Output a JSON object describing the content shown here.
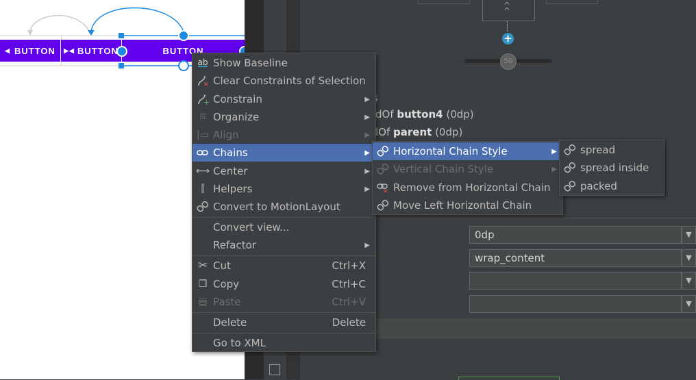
{
  "canvas": {
    "buttons": [
      "BUTTON",
      "BUTTON",
      "BUTTON"
    ]
  },
  "right_panel": {
    "slider_value": "50",
    "constraint_lines": [
      {
        "prefix": "dOf ",
        "target": "button4",
        "suffix": " (0dp)"
      },
      {
        "prefix": "lOf ",
        "target": "parent",
        "suffix": " (0dp)"
      }
    ],
    "fields": [
      "0dp",
      "wrap_content",
      "",
      ""
    ]
  },
  "context_menu": {
    "items": [
      {
        "icon": "baseline-icon",
        "label": "Show Baseline"
      },
      {
        "icon": "clear-constraints-icon",
        "label": "Clear Constraints of Selection"
      },
      {
        "icon": "constrain-icon",
        "label": "Constrain",
        "submenu": true
      },
      {
        "icon": "organize-icon",
        "label": "Organize",
        "submenu": true
      },
      {
        "icon": "align-icon",
        "label": "Align",
        "submenu": true,
        "disabled": true
      },
      {
        "icon": "chain-icon",
        "label": "Chains",
        "submenu": true,
        "selected": true
      },
      {
        "icon": "center-icon",
        "label": "Center",
        "submenu": true
      },
      {
        "icon": "helpers-icon",
        "label": "Helpers",
        "submenu": true
      },
      {
        "icon": "motion-layout-icon",
        "label": "Convert to MotionLayout"
      },
      {
        "label": "Convert view..."
      },
      {
        "label": "Refactor",
        "submenu": true
      },
      {
        "icon": "cut-icon",
        "label": "Cut",
        "shortcut": "Ctrl+X"
      },
      {
        "icon": "copy-icon",
        "label": "Copy",
        "shortcut": "Ctrl+C"
      },
      {
        "icon": "paste-icon",
        "label": "Paste",
        "shortcut": "Ctrl+V",
        "disabled": true
      },
      {
        "label": "Delete",
        "shortcut": "Delete"
      },
      {
        "label": "Go to XML"
      }
    ]
  },
  "chains_submenu": {
    "items": [
      {
        "label": "Horizontal Chain Style",
        "submenu": true,
        "selected": true
      },
      {
        "label": "Vertical Chain Style",
        "submenu": true,
        "disabled": true
      },
      {
        "label": "Remove from Horizontal Chain"
      },
      {
        "label": "Move Left Horizontal Chain"
      }
    ]
  },
  "chain_style_submenu": {
    "items": [
      "spread",
      "spread inside",
      "packed"
    ]
  }
}
